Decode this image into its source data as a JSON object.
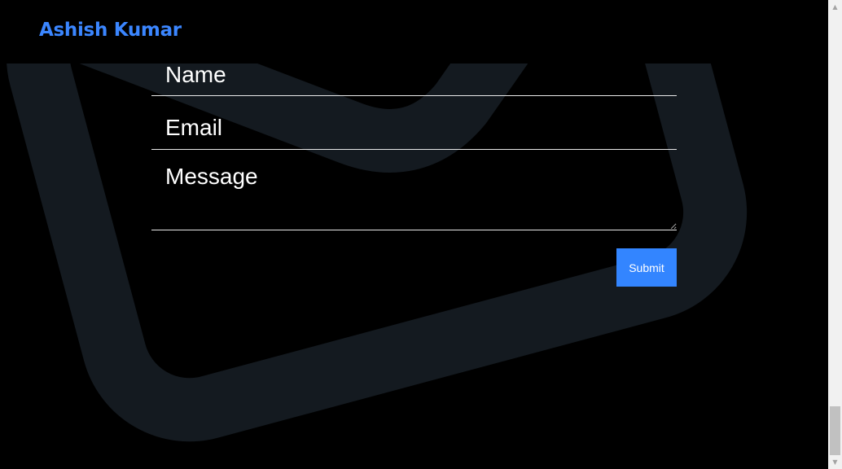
{
  "navbar": {
    "brand": "Ashish Kumar"
  },
  "contact_form": {
    "name_placeholder": "Name",
    "email_placeholder": "Email",
    "message_placeholder": "Message",
    "submit_label": "Submit"
  },
  "colors": {
    "brand": "#3b86ff",
    "button": "#3385ff",
    "background": "#000000",
    "envelope": "#141a20"
  },
  "icons": {
    "background": "envelope-icon"
  },
  "scrollbar": {
    "up": "▲",
    "down": "▼"
  }
}
